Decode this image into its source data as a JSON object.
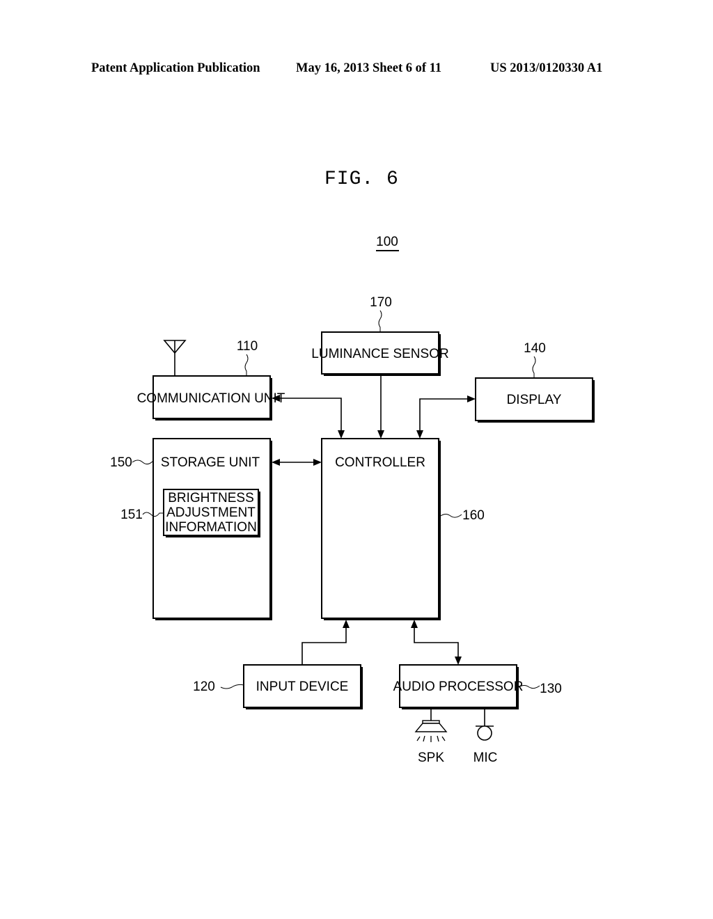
{
  "header": {
    "left": "Patent Application Publication",
    "middle": "May 16, 2013  Sheet 6 of 11",
    "right": "US 2013/0120330 A1"
  },
  "figure": {
    "title": "FIG. 6",
    "ref": "100"
  },
  "blocks": {
    "luminance_sensor": {
      "label": "LUMINANCE SENSOR",
      "ref": "170"
    },
    "communication_unit": {
      "label": "COMMUNICATION UNIT",
      "ref": "110"
    },
    "display": {
      "label": "DISPLAY",
      "ref": "140"
    },
    "storage_unit": {
      "label": "STORAGE UNIT",
      "ref": "150"
    },
    "brightness_info": {
      "lines": [
        "BRIGHTNESS",
        "ADJUSTMENT",
        "INFORMATION"
      ],
      "ref": "151"
    },
    "controller": {
      "label": "CONTROLLER",
      "ref": "160"
    },
    "input_device": {
      "label": "INPUT DEVICE",
      "ref": "120"
    },
    "audio_processor": {
      "label": "AUDIO PROCESSOR",
      "ref": "130"
    }
  },
  "peripherals": {
    "speaker": "SPK",
    "microphone": "MIC"
  },
  "connections": [
    {
      "from": "communication_unit",
      "to": "controller",
      "direction": "bidirectional"
    },
    {
      "from": "luminance_sensor",
      "to": "controller",
      "direction": "one-way"
    },
    {
      "from": "display",
      "to": "controller",
      "direction": "bidirectional"
    },
    {
      "from": "storage_unit",
      "to": "controller",
      "direction": "bidirectional"
    },
    {
      "from": "input_device",
      "to": "controller",
      "direction": "one-way"
    },
    {
      "from": "audio_processor",
      "to": "controller",
      "direction": "bidirectional"
    }
  ]
}
